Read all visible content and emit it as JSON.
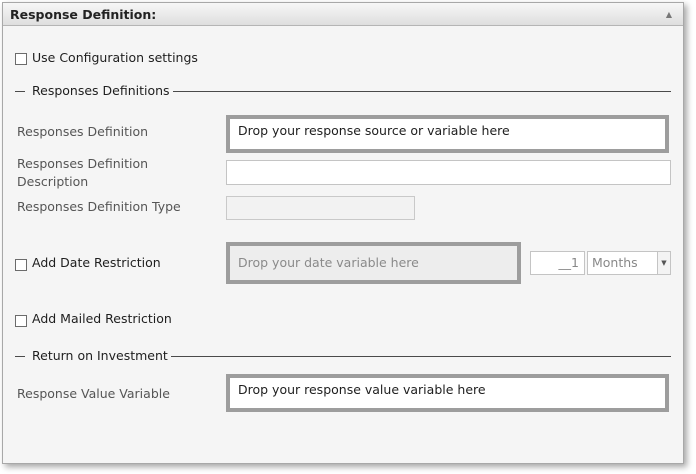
{
  "header": {
    "title": "Response Definition:"
  },
  "use_config": {
    "label": "Use Configuration settings"
  },
  "responses_section": {
    "title": "Responses Definitions"
  },
  "responses_definition": {
    "label": "Responses Definition",
    "placeholder": "Drop your response source or variable here"
  },
  "responses_description": {
    "label_line1": "Responses Definition",
    "label_line2": "Description",
    "value": ""
  },
  "responses_type": {
    "label": "Responses Definition Type",
    "value": ""
  },
  "date_restriction": {
    "label": "Add Date Restriction",
    "placeholder": "Drop your date variable here",
    "number": "__1",
    "unit": "Months"
  },
  "mailed_restriction": {
    "label": "Add Mailed Restriction"
  },
  "roi_section": {
    "title": "Return on Investment"
  },
  "response_value": {
    "label": "Response Value Variable",
    "placeholder": "Drop your response value variable here"
  }
}
